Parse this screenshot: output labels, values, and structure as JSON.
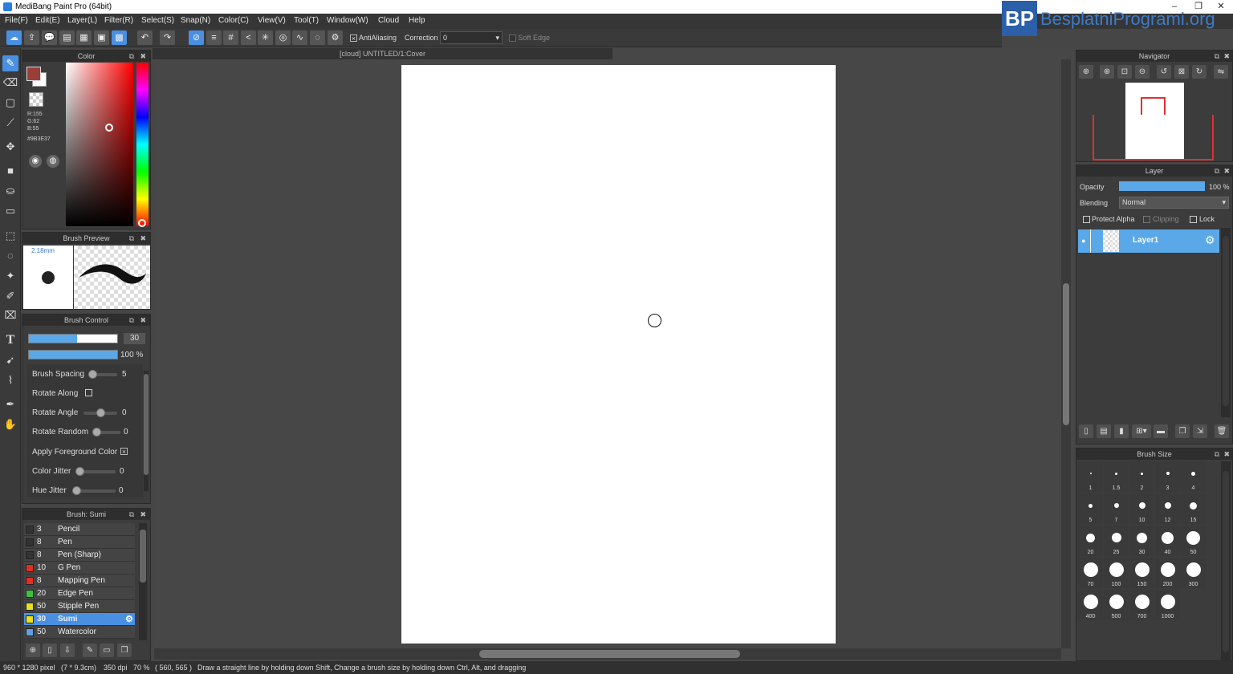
{
  "window": {
    "title": "MediBang Paint Pro (64bit)"
  },
  "logo": {
    "mark": "BP",
    "text": "BesplatniProgrami.org",
    "sub": "org"
  },
  "menu": [
    "File(F)",
    "Edit(E)",
    "Layer(L)",
    "Filter(R)",
    "Select(S)",
    "Snap(N)",
    "Color(C)",
    "View(V)",
    "Tool(T)",
    "Window(W)",
    "Cloud",
    "Help"
  ],
  "toolbar": {
    "antialiasing_label": "AntiAliasing",
    "correction_label": "Correction",
    "correction_value": "0",
    "soft_edge_label": "Soft Edge"
  },
  "color_panel": {
    "title": "Color",
    "r": "R:155",
    "g": "G:62",
    "b": "B:55",
    "hex": "#9B3E37",
    "foreground": "#9B3E37"
  },
  "brush_preview": {
    "title": "Brush Preview",
    "size": "2.18mm"
  },
  "brush_control": {
    "title": "Brush Control",
    "size_value": "30",
    "opacity_value": "100 %",
    "rows": [
      {
        "label": "Brush Spacing",
        "value": "5"
      },
      {
        "label": "Rotate Along",
        "value": ""
      },
      {
        "label": "Rotate Angle",
        "value": "0"
      },
      {
        "label": "Rotate Random",
        "value": "0"
      },
      {
        "label": "Apply Foreground Color",
        "value": ""
      },
      {
        "label": "Color Jitter",
        "value": "0"
      },
      {
        "label": "Hue Jitter",
        "value": "0"
      }
    ]
  },
  "brush_list": {
    "title": "Brush: Sumi",
    "items": [
      {
        "size": "3",
        "name": "Pencil",
        "color": "#333333"
      },
      {
        "size": "8",
        "name": "Pen",
        "color": "#333333"
      },
      {
        "size": "8",
        "name": "Pen (Sharp)",
        "color": "#333333"
      },
      {
        "size": "10",
        "name": "G Pen",
        "color": "#e03020"
      },
      {
        "size": "8",
        "name": "Mapping Pen",
        "color": "#e03020"
      },
      {
        "size": "20",
        "name": "Edge Pen",
        "color": "#40c040"
      },
      {
        "size": "50",
        "name": "Stipple Pen",
        "color": "#e8e020"
      },
      {
        "size": "30",
        "name": "Sumi",
        "color": "#e8e020"
      },
      {
        "size": "50",
        "name": "Watercolor",
        "color": "#60a0e0"
      }
    ]
  },
  "document": {
    "tab": "[cloud] UNTITLED/1:Cover"
  },
  "navigator": {
    "title": "Navigator"
  },
  "layer_panel": {
    "title": "Layer",
    "opacity_label": "Opacity",
    "opacity_value": "100 %",
    "blending_label": "Blending",
    "blending_value": "Normal",
    "protect_alpha": "Protect Alpha",
    "clipping": "Clipping",
    "lock": "Lock",
    "layer_name": "Layer1"
  },
  "brush_size": {
    "title": "Brush Size",
    "sizes": [
      "1",
      "1.5",
      "2",
      "3",
      "4",
      "5",
      "7",
      "10",
      "12",
      "15",
      "20",
      "25",
      "30",
      "40",
      "50",
      "70",
      "100",
      "150",
      "200",
      "300",
      "400",
      "500",
      "700",
      "1000"
    ]
  },
  "status": {
    "dims": "960 * 1280 pixel",
    "cm": "(7 * 9.3cm)",
    "dpi": "350 dpi",
    "zoom": "70 %",
    "coords": "( 560, 565 )",
    "hint": "Draw a straight line by holding down Shift, Change a brush size by holding down Ctrl, Alt, and dragging"
  }
}
